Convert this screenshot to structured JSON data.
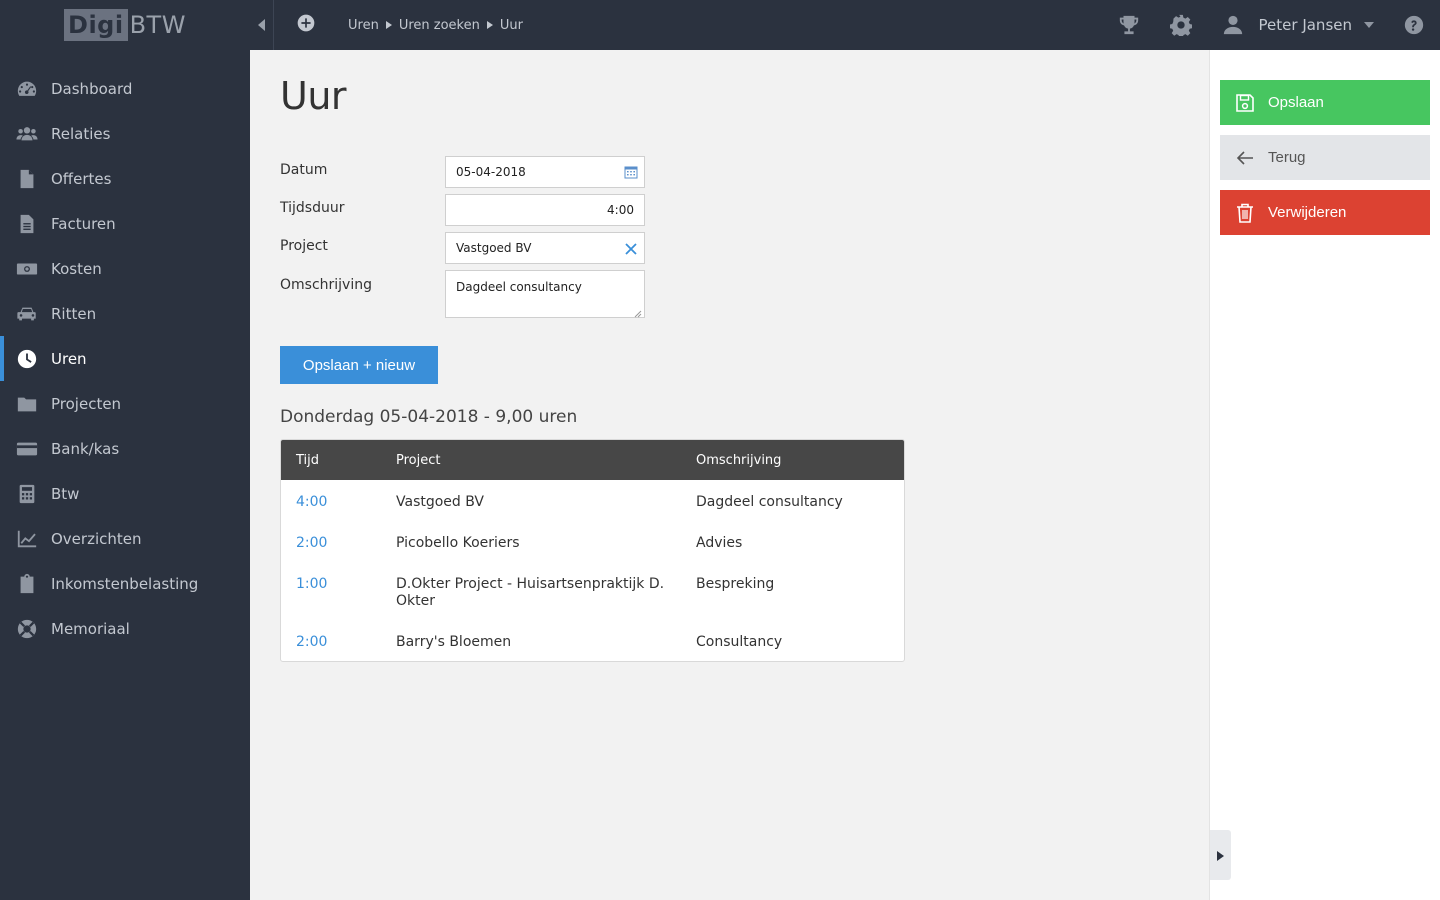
{
  "logo": {
    "part1": "Digi",
    "part2": "BTW"
  },
  "sidebar": {
    "items": [
      {
        "label": "Dashboard",
        "icon": "dashboard-icon"
      },
      {
        "label": "Relaties",
        "icon": "users-icon"
      },
      {
        "label": "Offertes",
        "icon": "file-icon"
      },
      {
        "label": "Facturen",
        "icon": "file-text-icon"
      },
      {
        "label": "Kosten",
        "icon": "money-icon"
      },
      {
        "label": "Ritten",
        "icon": "car-icon"
      },
      {
        "label": "Uren",
        "icon": "clock-icon",
        "active": true
      },
      {
        "label": "Projecten",
        "icon": "folder-icon"
      },
      {
        "label": "Bank/kas",
        "icon": "credit-card-icon"
      },
      {
        "label": "Btw",
        "icon": "calculator-icon"
      },
      {
        "label": "Overzichten",
        "icon": "chart-line-icon"
      },
      {
        "label": "Inkomstenbelasting",
        "icon": "clipboard-icon"
      },
      {
        "label": "Memoriaal",
        "icon": "lifebuoy-icon"
      }
    ]
  },
  "topbar": {
    "breadcrumb": [
      "Uren",
      "Uren zoeken",
      "Uur"
    ],
    "user_name": "Peter Jansen"
  },
  "page": {
    "title": "Uur"
  },
  "form": {
    "datum_label": "Datum",
    "datum_value": "05-04-2018",
    "tijdsduur_label": "Tijdsduur",
    "tijdsduur_value": "4:00",
    "project_label": "Project",
    "project_value": "Vastgoed BV",
    "omschrijving_label": "Omschrijving",
    "omschrijving_value": "Dagdeel consultancy",
    "save_new_label": "Opslaan + nieuw"
  },
  "day": {
    "heading": "Donderdag 05-04-2018 - 9,00 uren"
  },
  "table": {
    "headers": [
      "Tijd",
      "Project",
      "Omschrijving"
    ],
    "rows": [
      {
        "tijd": "4:00",
        "project": "Vastgoed BV",
        "omschrijving": "Dagdeel consultancy"
      },
      {
        "tijd": "2:00",
        "project": "Picobello Koeriers",
        "omschrijving": "Advies"
      },
      {
        "tijd": "1:00",
        "project": "D.Okter Project - Huisartsenpraktijk D. Okter",
        "omschrijving": "Bespreking"
      },
      {
        "tijd": "2:00",
        "project": "Barry's Bloemen",
        "omschrijving": "Consultancy"
      }
    ]
  },
  "actions": {
    "save_label": "Opslaan",
    "back_label": "Terug",
    "delete_label": "Verwijderen"
  },
  "colors": {
    "sidebar_bg": "#2b323f",
    "accent_blue": "#3a8fd9",
    "save_green": "#47c660",
    "delete_red": "#dc4232"
  }
}
